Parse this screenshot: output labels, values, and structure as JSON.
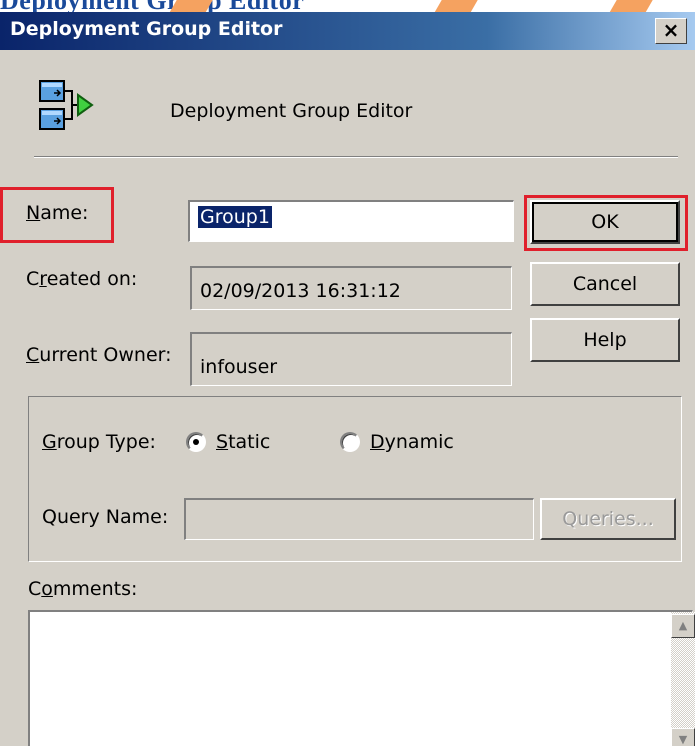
{
  "page_fragment": {
    "text": "Deployment Group Editor"
  },
  "window": {
    "title": "Deployment Group Editor",
    "close_label": "×"
  },
  "header": {
    "title": "Deployment Group Editor",
    "icon": "deployment-group-icon"
  },
  "form": {
    "name": {
      "label": "Name:",
      "value": "Group1"
    },
    "created_on": {
      "label": "Created on:",
      "value": "02/09/2013 16:31:12"
    },
    "current_owner": {
      "label": "Current Owner:",
      "value": "infouser"
    }
  },
  "buttons": {
    "ok": "OK",
    "cancel": "Cancel",
    "help": "Help"
  },
  "group_type": {
    "label": "Group Type:",
    "options": [
      {
        "label": "Static",
        "selected": true
      },
      {
        "label": "Dynamic",
        "selected": false
      }
    ]
  },
  "query": {
    "label": "Query Name:",
    "value": "",
    "button": "Queries..."
  },
  "comments": {
    "label": "Comments:",
    "value": ""
  },
  "colors": {
    "highlight": "#e0202c",
    "title_bar": "#0a246a",
    "dialog_bg": "#d4d0c8"
  }
}
